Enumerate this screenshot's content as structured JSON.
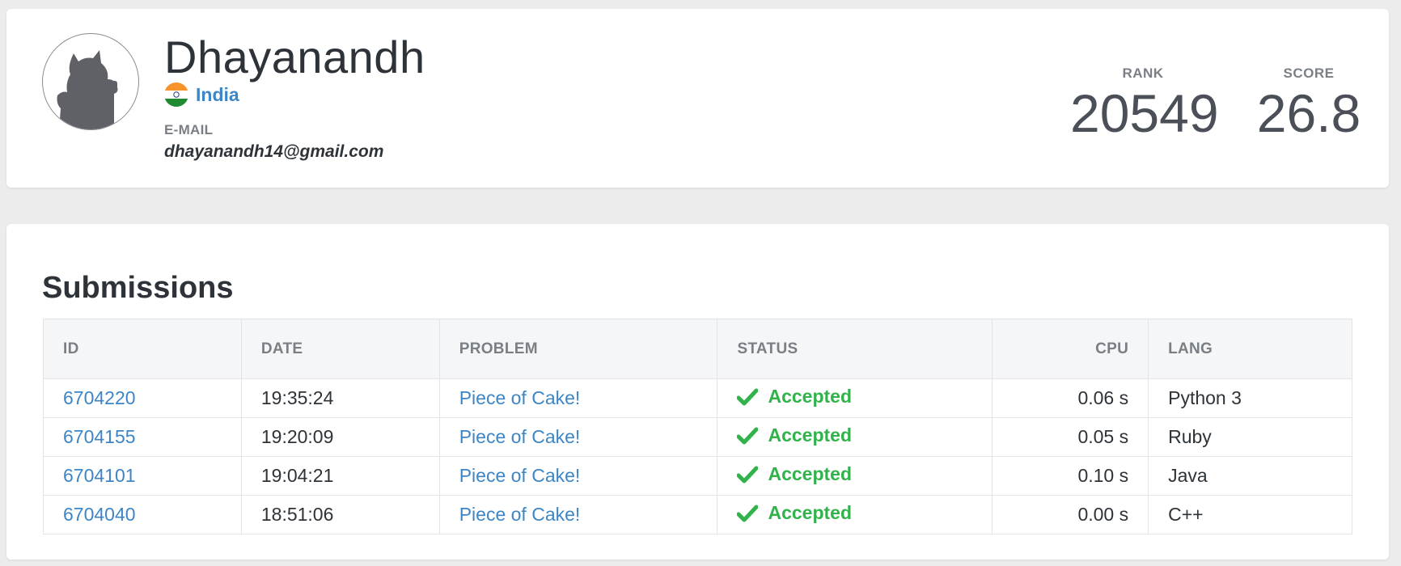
{
  "profile": {
    "name": "Dhayanandh",
    "country": "India",
    "email_label": "E-MAIL",
    "email": "dhayanandh14@gmail.com",
    "avatar_icon": "cat-silhouette-icon",
    "flag_icon": "india-flag-icon"
  },
  "stats": {
    "rank_label": "RANK",
    "rank_value": "20549",
    "score_label": "SCORE",
    "score_value": "26.8"
  },
  "submissions": {
    "title": "Submissions",
    "columns": {
      "id": "ID",
      "date": "DATE",
      "problem": "PROBLEM",
      "status": "STATUS",
      "cpu": "CPU",
      "lang": "LANG"
    },
    "rows": [
      {
        "id": "6704220",
        "date": "19:35:24",
        "problem": "Piece of Cake!",
        "status": "Accepted",
        "cpu": "0.06 s",
        "lang": "Python 3"
      },
      {
        "id": "6704155",
        "date": "19:20:09",
        "problem": "Piece of Cake!",
        "status": "Accepted",
        "cpu": "0.05 s",
        "lang": "Ruby"
      },
      {
        "id": "6704101",
        "date": "19:04:21",
        "problem": "Piece of Cake!",
        "status": "Accepted",
        "cpu": "0.10 s",
        "lang": "Java"
      },
      {
        "id": "6704040",
        "date": "18:51:06",
        "problem": "Piece of Cake!",
        "status": "Accepted",
        "cpu": "0.00 s",
        "lang": "C++"
      }
    ]
  },
  "colors": {
    "link": "#3e85c6",
    "accepted": "#30b34a",
    "text": "#2d3338",
    "muted": "#7a7f85",
    "background": "#ececec"
  }
}
